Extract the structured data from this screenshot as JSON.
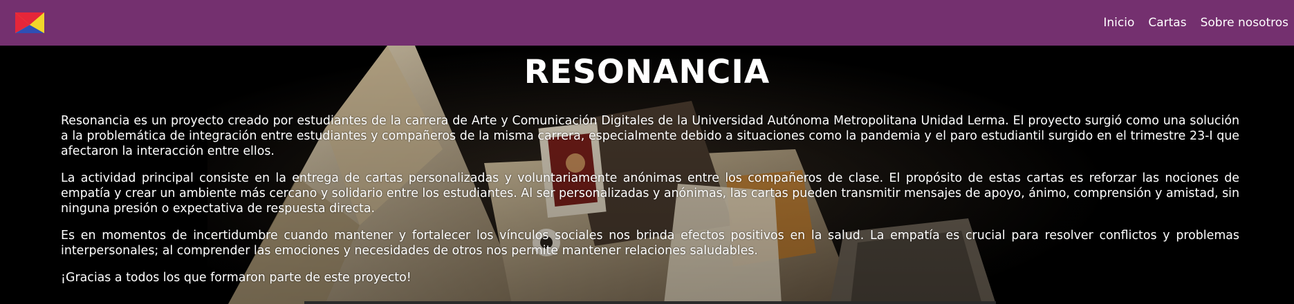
{
  "brand": {
    "logo_icon": "envelope-logo-icon",
    "colors": {
      "red": "#e5263a",
      "yellow": "#f2d52a",
      "blue": "#2e4fb5"
    }
  },
  "nav": {
    "links": [
      {
        "label": "Inicio"
      },
      {
        "label": "Cartas"
      },
      {
        "label": "Sobre nosotros"
      }
    ]
  },
  "hero": {
    "title": "RESONANCIA",
    "paragraphs": [
      "Resonancia es un proyecto creado por estudiantes de la carrera de Arte y Comunicación Digitales de la Universidad Autónoma Metropolitana Unidad Lerma. El proyecto surgió como una solución a la problemática de integración entre estudiantes y compañeros de la misma carrera, especialmente debido a situaciones como la pandemia y el paro estudiantil surgido en el trimestre 23-I que afectaron la interacción entre ellos.",
      "La actividad principal consiste en la entrega de cartas personalizadas y voluntariamente anónimas entre los compañeros de clase. El propósito de estas cartas es reforzar las nociones de empatía y crear un ambiente más cercano y solidario entre los estudiantes. Al ser personalizadas y anónimas, las cartas pueden transmitir mensajes de apoyo, ánimo, comprensión y amistad, sin ninguna presión o expectativa de respuesta directa.",
      "Es en momentos de incertidumbre cuando mantener y fortalecer los vínculos sociales nos brinda efectos positivos en la salud. La empatía es crucial para resolver conflictos y problemas interpersonales; al comprender las emociones y necesidades de otros nos permite mantener relaciones saludables.",
      "¡Gracias a todos los que formaron parte de este proyecto!"
    ]
  },
  "theme": {
    "navbar_bg": "#74306f",
    "page_bg": "#000000",
    "text": "#ffffff"
  }
}
